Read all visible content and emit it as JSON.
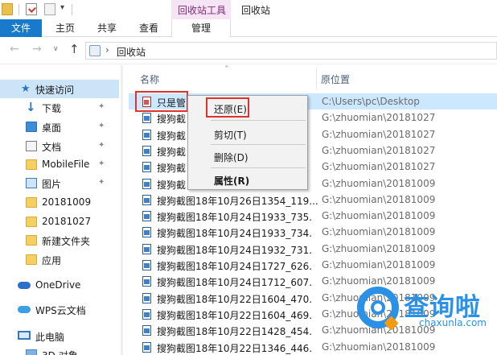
{
  "quick_access_toolbar": {
    "dropdown_glyph": "▾"
  },
  "context_tabs": {
    "manage_group": "回收站工具",
    "window_title": "回收站"
  },
  "ribbon": {
    "tabs": [
      "文件",
      "主页",
      "共享",
      "查看",
      "管理"
    ],
    "active_tab": "文件",
    "accent": "#1979ca"
  },
  "address_bar": {
    "back": "←",
    "forward": "→",
    "history": "∨",
    "up": "↑",
    "separator": "›",
    "path": "回收站"
  },
  "sidebar": {
    "items": [
      {
        "label": "快速访问",
        "icon": "star-icon",
        "pinned": false
      },
      {
        "label": "下载",
        "icon": "download-arrow-icon",
        "pinned": true
      },
      {
        "label": "桌面",
        "icon": "desktop-icon",
        "pinned": true
      },
      {
        "label": "文档",
        "icon": "document-icon",
        "pinned": true
      },
      {
        "label": "MobileFile",
        "icon": "folder-icon",
        "pinned": true
      },
      {
        "label": "图片",
        "icon": "picture-icon",
        "pinned": true
      },
      {
        "label": "20181009",
        "icon": "folder-icon",
        "pinned": false
      },
      {
        "label": "20181027",
        "icon": "folder-icon",
        "pinned": false
      },
      {
        "label": "新建文件夹",
        "icon": "folder-icon",
        "pinned": false
      },
      {
        "label": "应用",
        "icon": "folder-icon",
        "pinned": false
      },
      {
        "label": "OneDrive",
        "icon": "cloud-icon",
        "pinned": false
      },
      {
        "label": "WPS云文档",
        "icon": "wps-cloud-icon",
        "pinned": false
      },
      {
        "label": "此电脑",
        "icon": "computer-icon",
        "pinned": false
      },
      {
        "label": "3D 对象",
        "icon": "3d-objects-icon",
        "pinned": false
      }
    ],
    "pin_glyph": "📌"
  },
  "columns": {
    "name": "名称",
    "original_location": "原位置",
    "sort_glyph": "⌃"
  },
  "files": [
    {
      "name": "只是管",
      "location": "C:\\Users\\pc\\Desktop"
    },
    {
      "name": "搜狗截",
      "location": "G:\\zhuomian\\20181027"
    },
    {
      "name": "搜狗截",
      "location": "G:\\zhuomian\\20181027"
    },
    {
      "name": "搜狗截",
      "location": "G:\\zhuomian\\20181027"
    },
    {
      "name": "搜狗截",
      "location": "G:\\zhuomian\\20181027"
    },
    {
      "name": "搜狗截",
      "location": "G:\\zhuomian\\20181009"
    },
    {
      "name": "搜狗截图18年10月26日1354_119...",
      "location": "G:\\zhuomian\\20181009"
    },
    {
      "name": "搜狗截图18年10月24日1933_735.",
      "location": "G:\\zhuomian\\20181009"
    },
    {
      "name": "搜狗截图18年10月24日1933_734.",
      "location": "G:\\zhuomian\\20181009"
    },
    {
      "name": "搜狗截图18年10月24日1932_731.",
      "location": "G:\\zhuomian\\20181009"
    },
    {
      "name": "搜狗截图18年10月24日1727_626.",
      "location": "G:\\zhuomian\\20181009"
    },
    {
      "name": "搜狗截图18年10月24日1712_607.",
      "location": "G:\\zhuomian\\20181009"
    },
    {
      "name": "搜狗截图18年10月22日1604_470.",
      "location": "G:\\zhuomian\\20181009"
    },
    {
      "name": "搜狗截图18年10月22日1604_469.",
      "location": "G:\\zhuomian\\20181009"
    },
    {
      "name": "搜狗截图18年10月22日1428_454.",
      "location": "G:\\zhuomian\\20181009"
    },
    {
      "name": "搜狗截图18年10月22日1346_446.",
      "location": "G:\\zhuomian\\20181009"
    }
  ],
  "selected_file_index": 0,
  "context_menu": {
    "restore": "还原(E)",
    "cut": "剪切(T)",
    "delete": "删除(D)",
    "properties": "属性(R)"
  },
  "watermark": {
    "chinese": "查询啦",
    "english": "chaxunla.com",
    "color": "#2a91e6",
    "accent": "#f29a12"
  },
  "highlight_color": "#e0322d"
}
